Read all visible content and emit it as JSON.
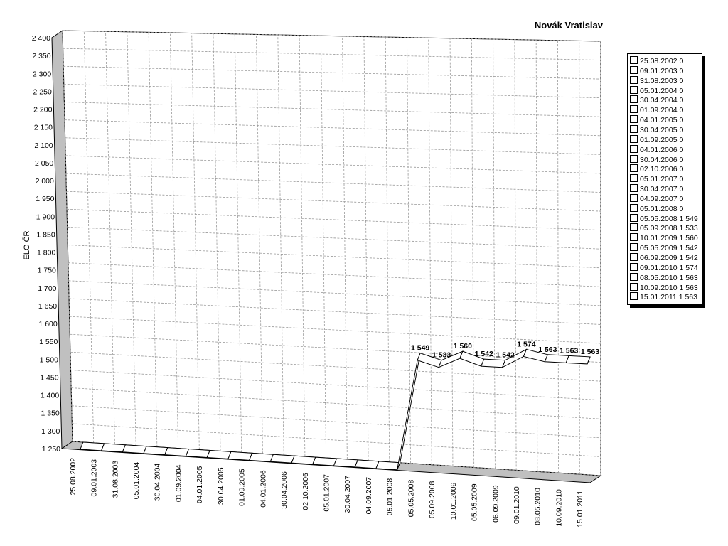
{
  "chart_data": {
    "type": "line",
    "title": "Novák Vratislav",
    "ylabel": "ELO ČR",
    "xlabel": "",
    "ylim": [
      1250,
      2400
    ],
    "yticks": [
      1250,
      1300,
      1350,
      1400,
      1450,
      1500,
      1550,
      1600,
      1650,
      1700,
      1750,
      1800,
      1850,
      1900,
      1950,
      2000,
      2050,
      2100,
      2150,
      2200,
      2250,
      2300,
      2350,
      2400
    ],
    "ytick_labels": [
      "1 250",
      "1 300",
      "1 350",
      "1 400",
      "1 450",
      "1 500",
      "1 550",
      "1 600",
      "1 650",
      "1 700",
      "1 750",
      "1 800",
      "1 850",
      "1 900",
      "1 950",
      "2 000",
      "2 050",
      "2 100",
      "2 150",
      "2 200",
      "2 250",
      "2 300",
      "2 350",
      "2 400"
    ],
    "categories": [
      "25.08.2002",
      "09.01.2003",
      "31.08.2003",
      "05.01.2004",
      "30.04.2004",
      "01.09.2004",
      "04.01.2005",
      "30.04.2005",
      "01.09.2005",
      "04.01.2006",
      "30.04.2006",
      "02.10.2006",
      "05.01.2007",
      "30.04.2007",
      "04.09.2007",
      "05.01.2008",
      "05.05.2008",
      "05.09.2008",
      "10.01.2009",
      "05.05.2009",
      "06.09.2009",
      "09.01.2010",
      "08.05.2010",
      "10.09.2010",
      "15.01.2011"
    ],
    "values": [
      0,
      0,
      0,
      0,
      0,
      0,
      0,
      0,
      0,
      0,
      0,
      0,
      0,
      0,
      0,
      0,
      1549,
      1533,
      1560,
      1542,
      1542,
      1574,
      1563,
      1563,
      1563
    ],
    "data_labels": [
      "",
      "",
      "",
      "",
      "",
      "",
      "",
      "",
      "",
      "",
      "",
      "",
      "",
      "",
      "",
      "",
      "1 549",
      "1 533",
      "1 560",
      "1 542",
      "1 542",
      "1 574",
      "1 563",
      "1 563",
      "1 563"
    ],
    "legend": [
      "25.08.2002 0",
      "09.01.2003 0",
      "31.08.2003 0",
      "05.01.2004 0",
      "30.04.2004 0",
      "01.09.2004 0",
      "04.01.2005 0",
      "30.04.2005 0",
      "01.09.2005 0",
      "04.01.2006 0",
      "30.04.2006 0",
      "02.10.2006 0",
      "05.01.2007 0",
      "30.04.2007 0",
      "04.09.2007 0",
      "05.01.2008 0",
      "05.05.2008 1 549",
      "05.09.2008 1 533",
      "10.01.2009 1 560",
      "05.05.2009 1 542",
      "06.09.2009 1 542",
      "09.01.2010 1 574",
      "08.05.2010 1 563",
      "10.09.2010 1 563",
      "15.01.2011 1 563"
    ],
    "legend_position": "right",
    "grid": true,
    "style": "3d",
    "series_color": "#ffffff"
  }
}
